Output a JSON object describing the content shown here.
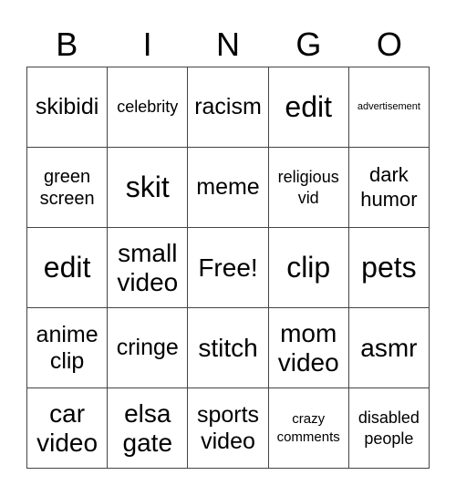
{
  "header": {
    "letters": [
      "B",
      "I",
      "N",
      "G",
      "O"
    ]
  },
  "cells": [
    [
      "skibidi",
      "celebrity",
      "racism",
      "edit",
      "advertisement"
    ],
    [
      "green screen",
      "skit",
      "meme",
      "religious vid",
      "dark humor"
    ],
    [
      "edit",
      "small video",
      "Free!",
      "clip",
      "pets"
    ],
    [
      "anime clip",
      "cringe",
      "stitch",
      "mom video",
      "asmr"
    ],
    [
      "car video",
      "elsa gate",
      "sports video",
      "crazy comments",
      "disabled people"
    ]
  ]
}
